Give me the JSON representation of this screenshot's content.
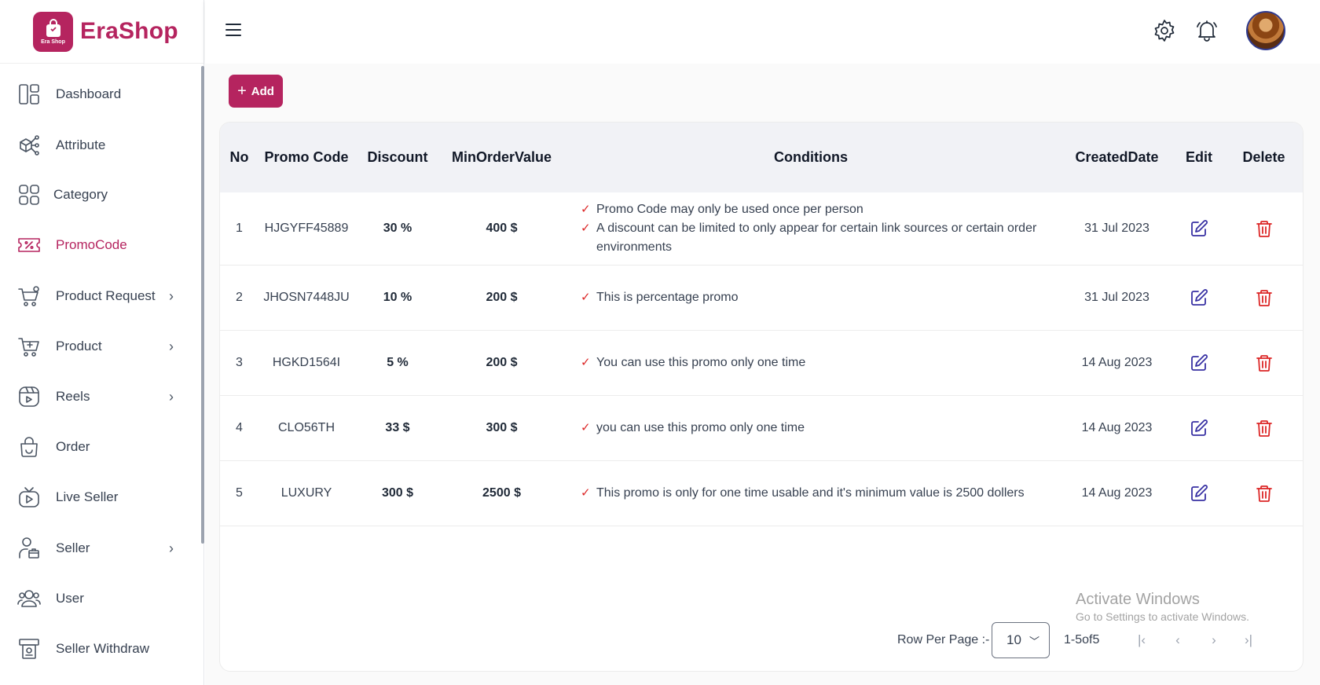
{
  "brand": {
    "name": "EraShop",
    "logo_text": "Era Shop"
  },
  "sidebar": {
    "items": [
      {
        "label": "Dashboard",
        "icon": "dashboard-icon",
        "has_chevron": false
      },
      {
        "label": "Attribute",
        "icon": "attribute-icon",
        "has_chevron": false
      },
      {
        "label": "Category",
        "icon": "category-icon",
        "has_chevron": false
      },
      {
        "label": "PromoCode",
        "icon": "promocode-icon",
        "has_chevron": false,
        "active": true
      },
      {
        "label": "Product Request",
        "icon": "product-request-icon",
        "has_chevron": true
      },
      {
        "label": "Product",
        "icon": "product-icon",
        "has_chevron": true
      },
      {
        "label": "Reels",
        "icon": "reels-icon",
        "has_chevron": true
      },
      {
        "label": "Order",
        "icon": "order-icon",
        "has_chevron": false
      },
      {
        "label": "Live Seller",
        "icon": "live-seller-icon",
        "has_chevron": false
      },
      {
        "label": "Seller",
        "icon": "seller-icon",
        "has_chevron": true
      },
      {
        "label": "User",
        "icon": "user-icon",
        "has_chevron": false
      },
      {
        "label": "Seller Withdraw",
        "icon": "withdraw-icon",
        "has_chevron": false
      }
    ]
  },
  "header": {
    "icons": [
      "menu-icon",
      "settings-icon",
      "bell-icon",
      "avatar"
    ]
  },
  "toolbar": {
    "add_label": "Add"
  },
  "table": {
    "headers": {
      "no": "No",
      "promo_code": "Promo Code",
      "discount": "Discount",
      "min_order": "MinOrderValue",
      "conditions": "Conditions",
      "created": "CreatedDate",
      "edit": "Edit",
      "delete": "Delete"
    },
    "rows": [
      {
        "no": "1",
        "code": "HJGYFF45889",
        "discount": "30 %",
        "min_order": "400 $",
        "conditions": [
          "Promo Code may only be used once per person",
          "A discount can be limited to only appear for certain link sources or certain order environments"
        ],
        "created": "31 Jul 2023"
      },
      {
        "no": "2",
        "code": "JHOSN7448JU",
        "discount": "10 %",
        "min_order": "200 $",
        "conditions": [
          "This is percentage promo"
        ],
        "created": "31 Jul 2023"
      },
      {
        "no": "3",
        "code": "HGKD1564I",
        "discount": "5 %",
        "min_order": "200 $",
        "conditions": [
          "You can use this promo only one time"
        ],
        "created": "14 Aug 2023"
      },
      {
        "no": "4",
        "code": "CLO56TH",
        "discount": "33 $",
        "min_order": "300 $",
        "conditions": [
          "you can use this promo only one time"
        ],
        "created": "14 Aug 2023"
      },
      {
        "no": "5",
        "code": "LUXURY",
        "discount": "300 $",
        "min_order": "2500 $",
        "conditions": [
          "This promo is only for one time usable and it's minimum value is 2500 dollers"
        ],
        "created": "14 Aug 2023"
      }
    ]
  },
  "pagination": {
    "rows_per_page_label": "Row Per Page :-",
    "rows_per_page": "10",
    "range": "1-5of5",
    "buttons": [
      "first-page",
      "prev-page",
      "next-page",
      "last-page"
    ]
  },
  "watermark": {
    "line1": "Activate Windows",
    "line2": "Go to Settings to activate Windows."
  },
  "colors": {
    "accent": "#b5245f",
    "edit": "#3730a3",
    "delete": "#dc2626",
    "check": "#dc2626",
    "header_bg": "#f1f2f6"
  }
}
